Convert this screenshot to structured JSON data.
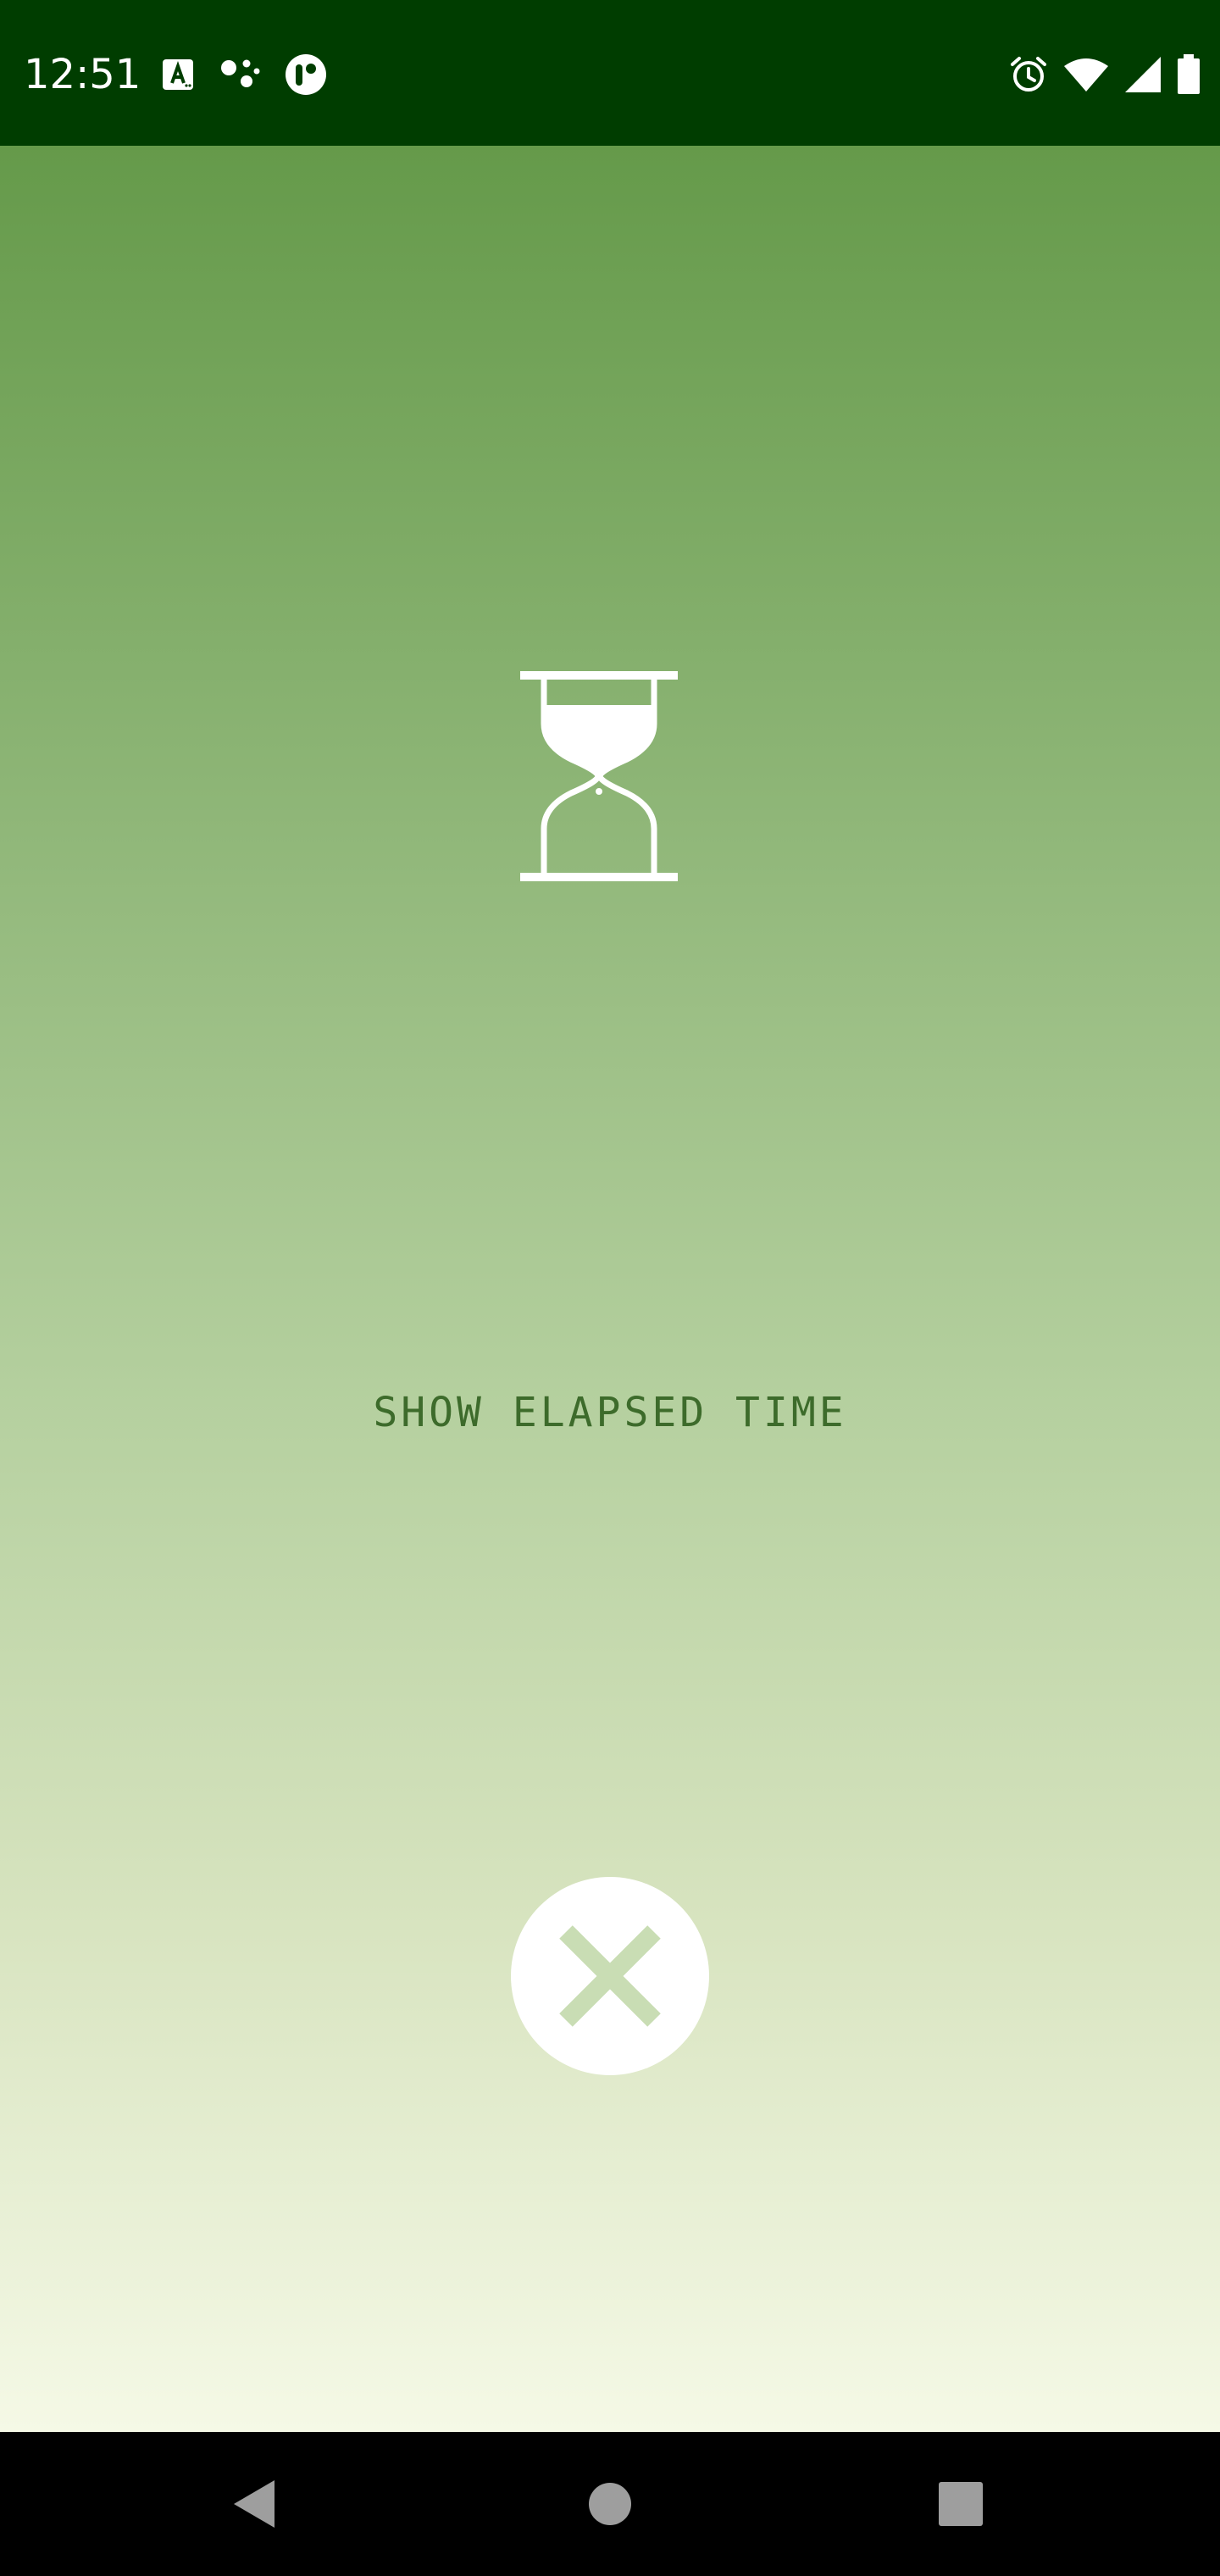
{
  "status_bar": {
    "time": "12:51",
    "background_color": "#003d00",
    "left_icons": [
      "font-a-icon",
      "assistant-dots-icon",
      "app-circle-icon"
    ],
    "right_icons": [
      "alarm-icon",
      "wifi-icon",
      "cell-signal-icon",
      "battery-icon"
    ]
  },
  "main": {
    "gradient_colors": [
      "#659a4a",
      "#f5f9e6"
    ],
    "center_icon": "hourglass-icon",
    "elapsed_button_label": "SHOW ELAPSED TIME",
    "elapsed_button_color": "#3d6b2b",
    "close_button_icon": "close-icon"
  },
  "nav_bar": {
    "buttons": [
      "back-icon",
      "home-icon",
      "recents-icon"
    ]
  }
}
